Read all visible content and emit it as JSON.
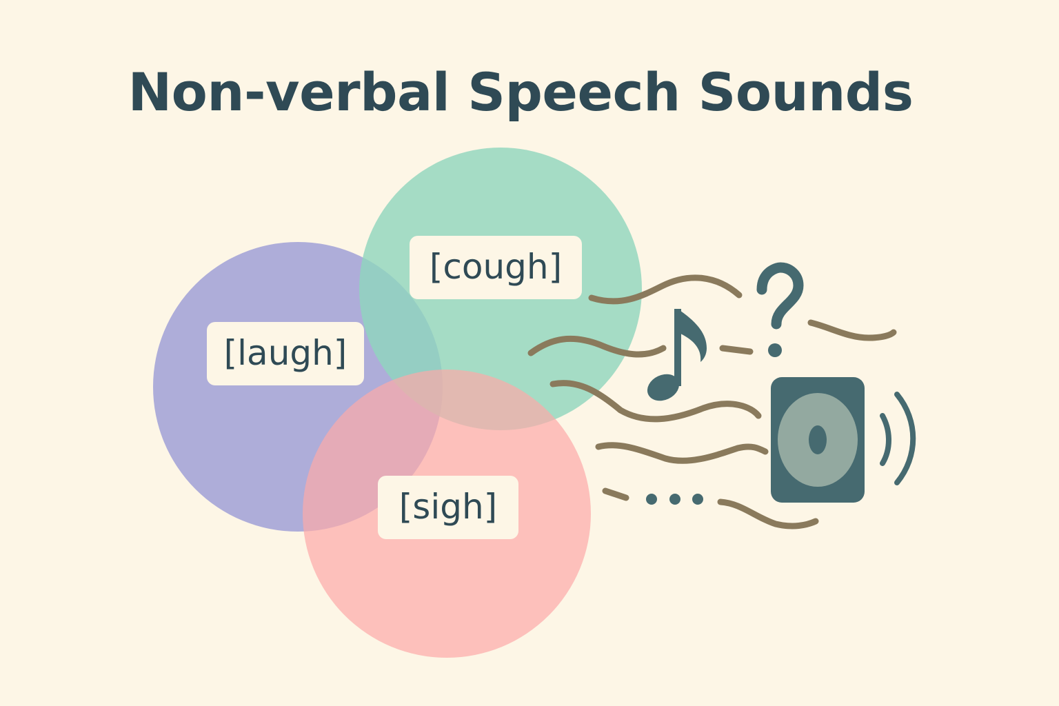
{
  "title": "Non-verbal Speech Sounds",
  "labels": {
    "cough": "[cough]",
    "laugh": "[laugh]",
    "sigh": "[sigh]"
  },
  "colors": {
    "background": "#fdf6e6",
    "text": "#2f4a55",
    "circle_cough": "#8fd6bd",
    "circle_laugh": "#8f90d4",
    "circle_sigh": "#fcaaa8",
    "wave": "#8a7a5c",
    "speaker": "#466a70",
    "speaker_cone": "#93a9a0"
  },
  "icons": [
    "music-note-icon",
    "question-mark-icon",
    "speaker-icon",
    "ellipsis-icon",
    "sound-wave-icon"
  ]
}
